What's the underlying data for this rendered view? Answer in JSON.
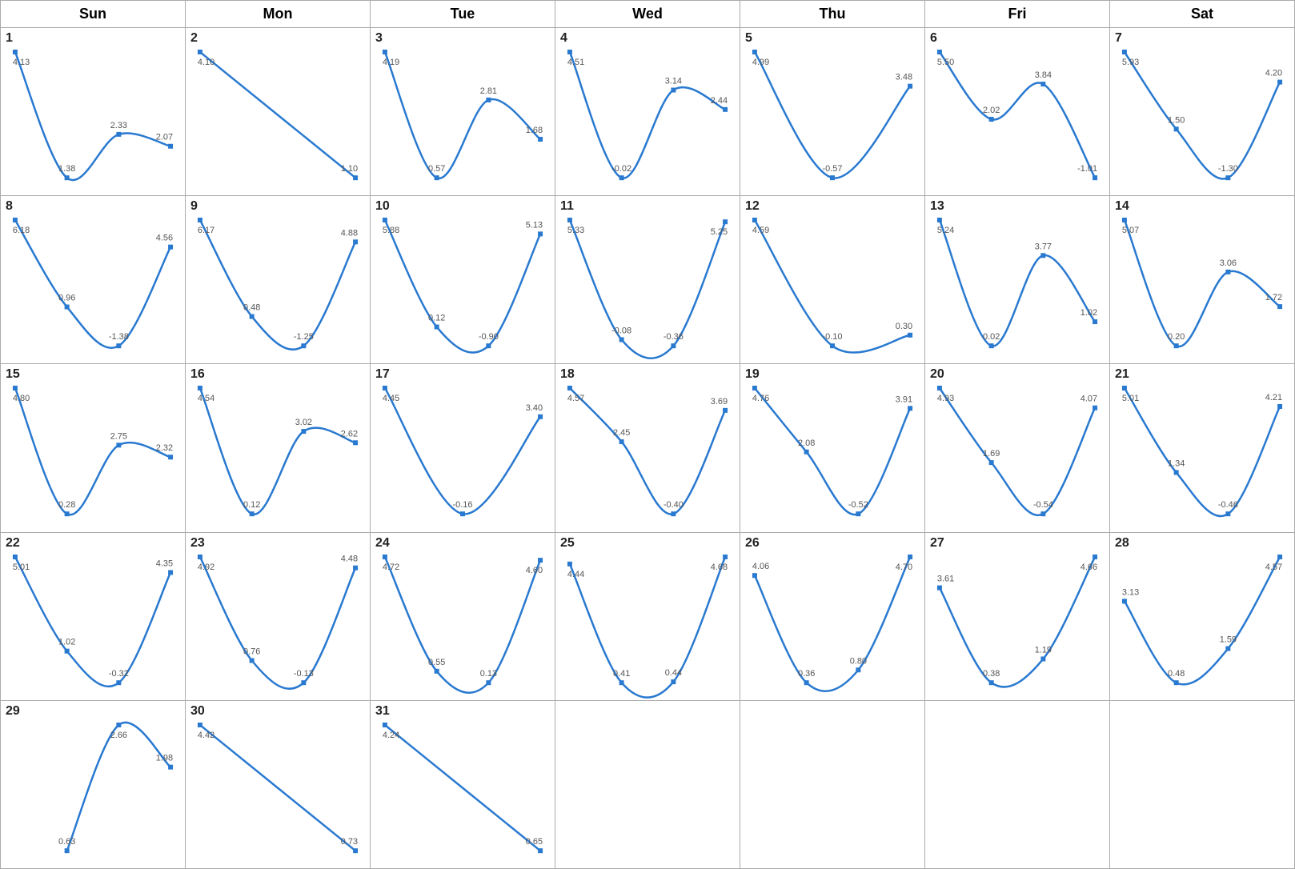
{
  "headers": [
    "Sun",
    "Mon",
    "Tue",
    "Wed",
    "Thu",
    "Fri",
    "Sat"
  ],
  "days": [
    {
      "day": 1,
      "values": [
        4.13,
        1.38,
        2.33,
        2.07
      ],
      "points": [
        0,
        1,
        2,
        3
      ]
    },
    {
      "day": 2,
      "values": [
        4.1,
        1.1
      ],
      "points": [
        0,
        1
      ]
    },
    {
      "day": 3,
      "values": [
        4.19,
        0.57,
        2.81,
        1.68
      ],
      "points": [
        0,
        1,
        2,
        3
      ]
    },
    {
      "day": 4,
      "values": [
        4.51,
        -0.02,
        3.14,
        2.44
      ],
      "points": [
        0,
        1,
        2,
        3
      ]
    },
    {
      "day": 5,
      "values": [
        4.99,
        -0.57,
        3.48
      ],
      "points": [
        0,
        1,
        2
      ]
    },
    {
      "day": 6,
      "values": [
        5.5,
        2.02,
        3.84,
        -1.01
      ],
      "points": [
        0,
        1,
        2,
        3
      ]
    },
    {
      "day": 7,
      "values": [
        5.93,
        1.5,
        -1.3,
        4.2
      ],
      "points": [
        0,
        1,
        2,
        3
      ]
    },
    {
      "day": 8,
      "values": [
        6.18,
        0.96,
        -1.38,
        4.56
      ],
      "points": [
        0,
        1,
        2,
        3
      ]
    },
    {
      "day": 9,
      "values": [
        6.17,
        0.48,
        -1.25,
        4.88
      ],
      "points": [
        0,
        1,
        2,
        3
      ]
    },
    {
      "day": 10,
      "values": [
        5.88,
        0.12,
        -0.9,
        5.13
      ],
      "points": [
        0,
        1,
        2,
        3
      ]
    },
    {
      "day": 11,
      "values": [
        5.33,
        -0.08,
        -0.36,
        5.25
      ],
      "points": [
        0,
        1,
        2,
        3
      ]
    },
    {
      "day": 12,
      "values": [
        4.59,
        -0.1,
        0.3
      ],
      "points": [
        0,
        1,
        2
      ]
    },
    {
      "day": 13,
      "values": [
        5.24,
        0.02,
        3.77,
        1.02
      ],
      "points": [
        0,
        1,
        2,
        3
      ]
    },
    {
      "day": 14,
      "values": [
        5.07,
        0.2,
        3.06,
        1.72
      ],
      "points": [
        0,
        1,
        2,
        3
      ]
    },
    {
      "day": 15,
      "values": [
        4.8,
        0.28,
        2.75,
        2.32
      ],
      "points": [
        0,
        1,
        2,
        3
      ]
    },
    {
      "day": 16,
      "values": [
        4.54,
        0.12,
        3.02,
        2.62
      ],
      "points": [
        0,
        1,
        2,
        3
      ]
    },
    {
      "day": 17,
      "values": [
        4.45,
        -0.16,
        3.4
      ],
      "points": [
        0,
        1,
        2
      ]
    },
    {
      "day": 18,
      "values": [
        4.57,
        2.45,
        -0.4,
        3.69
      ],
      "points": [
        0,
        1,
        2,
        3
      ]
    },
    {
      "day": 19,
      "values": [
        4.76,
        2.08,
        -0.52,
        3.91
      ],
      "points": [
        0,
        1,
        2,
        3
      ]
    },
    {
      "day": 20,
      "values": [
        4.93,
        1.69,
        -0.54,
        4.07
      ],
      "points": [
        0,
        1,
        2,
        3
      ]
    },
    {
      "day": 21,
      "values": [
        5.01,
        1.34,
        -0.46,
        4.21
      ],
      "points": [
        0,
        1,
        2,
        3
      ]
    },
    {
      "day": 22,
      "values": [
        5.01,
        1.02,
        -0.32,
        4.35
      ],
      "points": [
        0,
        1,
        2,
        3
      ]
    },
    {
      "day": 23,
      "values": [
        4.92,
        0.76,
        -0.13,
        4.48
      ],
      "points": [
        0,
        1,
        2,
        3
      ]
    },
    {
      "day": 24,
      "values": [
        4.72,
        0.55,
        0.13,
        4.6
      ],
      "points": [
        0,
        1,
        2,
        3
      ]
    },
    {
      "day": 25,
      "values": [
        4.44,
        0.41,
        0.44,
        4.68
      ],
      "points": [
        0,
        1,
        2,
        3
      ]
    },
    {
      "day": 26,
      "values": [
        4.06,
        0.36,
        0.8,
        4.7
      ],
      "points": [
        0,
        1,
        2,
        3
      ]
    },
    {
      "day": 27,
      "values": [
        3.61,
        0.38,
        1.19,
        4.66
      ],
      "points": [
        0,
        1,
        2,
        3
      ]
    },
    {
      "day": 28,
      "values": [
        3.13,
        0.48,
        1.59,
        4.57
      ],
      "points": [
        0,
        1,
        2,
        3
      ]
    },
    {
      "day": 29,
      "values": [
        null,
        0.63,
        2.66,
        1.98
      ],
      "points": [
        1,
        2,
        3
      ]
    },
    {
      "day": 30,
      "values": [
        4.42,
        0.73
      ],
      "points": [
        0,
        1
      ]
    },
    {
      "day": 31,
      "values": [
        4.24,
        0.65
      ],
      "points": [
        0,
        1
      ]
    }
  ],
  "colors": {
    "line": "#2979d0",
    "point": "#2979d0",
    "text": "#555",
    "border": "#aaa"
  }
}
